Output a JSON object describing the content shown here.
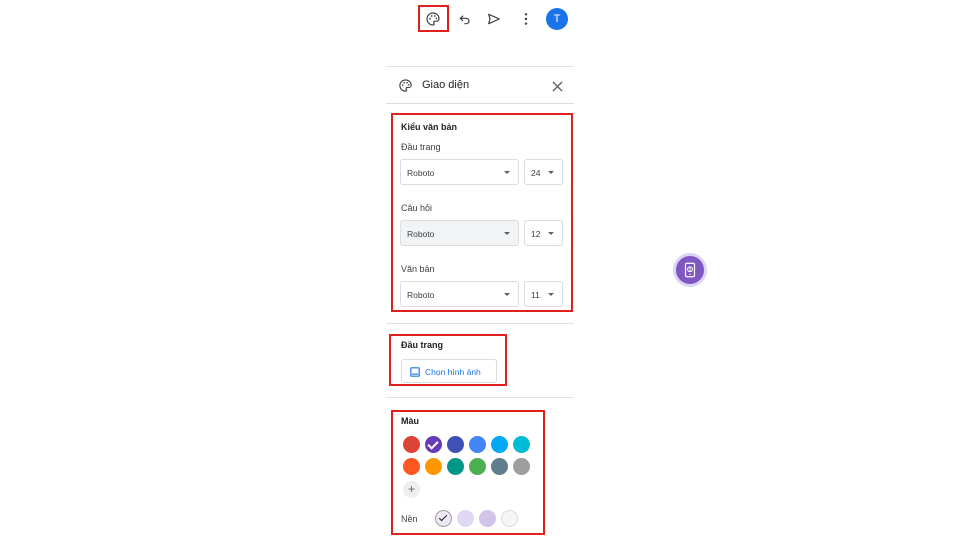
{
  "toolbar": {
    "avatar_letter": "T",
    "icons": [
      "palette-icon",
      "undo-icon",
      "send-icon",
      "more-vert-icon"
    ]
  },
  "panel": {
    "title": "Giao diện",
    "text_style": {
      "heading": "Kiểu văn bản",
      "rows": [
        {
          "label": "Đầu trang",
          "font": "Roboto",
          "size": "24"
        },
        {
          "label": "Câu hỏi",
          "font": "Roboto",
          "size": "12"
        },
        {
          "label": "Văn bản",
          "font": "Roboto",
          "size": "11"
        }
      ]
    },
    "header_section": {
      "heading": "Đầu trang",
      "choose_image_label": "Chọn hình ảnh"
    },
    "color_section": {
      "heading": "Màu",
      "theme_colors": [
        "#db4437",
        "#673ab7",
        "#3f51b5",
        "#4285f4",
        "#03a9f4",
        "#00bcd4",
        "#ff5722",
        "#ff9800",
        "#009688",
        "#4caf50",
        "#607d8b",
        "#9e9e9e"
      ],
      "selected_theme_color": "#673ab7",
      "background_label": "Nền",
      "background_colors": [
        "#ede7f6",
        "#e0d8f2",
        "#d1c4e9",
        "#f6f6f6"
      ],
      "selected_background_color": "#ede7f6"
    }
  },
  "colors": {
    "accent": "#1a73e8",
    "highlight": "#e0201c"
  }
}
